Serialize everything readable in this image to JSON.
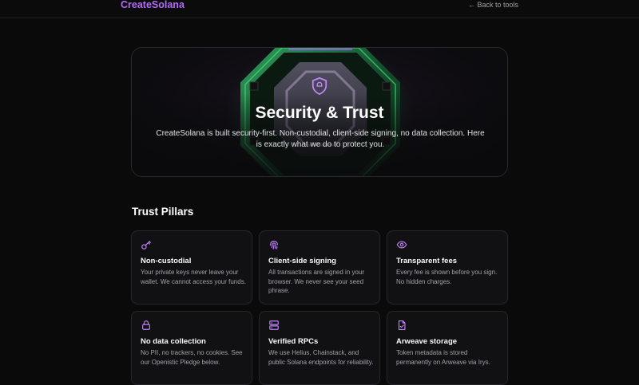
{
  "header": {
    "brand": "CreateSolana",
    "back_link": "← Back to tools"
  },
  "hero": {
    "title": "Security & Trust",
    "subtitle": "CreateSolana is built security-first. Non-custodial, client-side signing, no data collection. Here is exactly what we do to protect you."
  },
  "pillars": {
    "heading": "Trust Pillars",
    "items": [
      {
        "icon": "key-icon",
        "title": "Non-custodial",
        "desc": "Your private keys never leave your wallet. We cannot access your funds."
      },
      {
        "icon": "fingerprint-icon",
        "title": "Client-side signing",
        "desc": "All transactions are signed in your browser. We never see your seed phrase."
      },
      {
        "icon": "eye-icon",
        "title": "Transparent fees",
        "desc": "Every fee is shown before you sign. No hidden charges."
      },
      {
        "icon": "lock-icon",
        "title": "No data collection",
        "desc": "No PII, no trackers, no cookies. See our Openistic Pledge below."
      },
      {
        "icon": "server-icon",
        "title": "Verified RPCs",
        "desc": "We use Helius, Chainstack, and public Solana endpoints for reliability."
      },
      {
        "icon": "file-check-icon",
        "title": "Arweave storage",
        "desc": "Token metadata is stored permanently on Arweave via Irys."
      }
    ]
  },
  "colors": {
    "accent": "#b26cf5",
    "icon": "#c084fc",
    "hero_glow": "#22c55e"
  }
}
